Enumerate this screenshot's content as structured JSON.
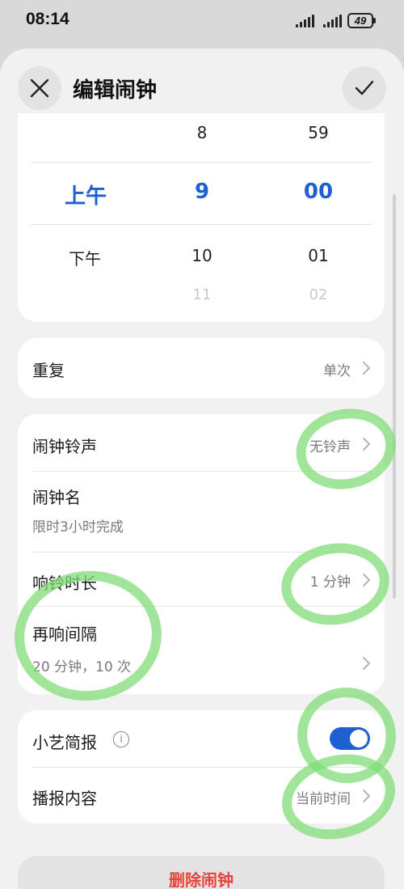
{
  "status_bar": {
    "time": "08:14",
    "battery": "49"
  },
  "header": {
    "title": "编辑闹钟",
    "close_icon": "close-icon",
    "confirm_icon": "check-icon"
  },
  "picker": {
    "period": {
      "above": "",
      "selected": "上午",
      "below": "下午",
      "faint": ""
    },
    "hour": {
      "above": "8",
      "selected": "9",
      "below": "10",
      "faint": "11"
    },
    "minute": {
      "above": "59",
      "selected": "00",
      "below": "01",
      "faint": "02"
    },
    "accent_color": "#1e5fd1"
  },
  "repeat": {
    "title": "重复",
    "value": "单次"
  },
  "settings": {
    "ringtone": {
      "title": "闹钟铃声",
      "value": "无铃声"
    },
    "alarm_name": {
      "title": "闹钟名",
      "value": "限时3小时完成"
    },
    "ring_duration": {
      "title": "响铃时长",
      "value": "1 分钟"
    },
    "snooze": {
      "title": "再响间隔",
      "value": "20 分钟，10 次"
    }
  },
  "briefing": {
    "xiaoyi": {
      "title": "小艺简报",
      "toggle_on": true,
      "info_icon": "info-icon"
    },
    "content": {
      "title": "播报内容",
      "value": "当前时间"
    }
  },
  "delete": {
    "label": "删除闹钟",
    "color": "#e8433a"
  },
  "annotation_color": "#80dc78"
}
